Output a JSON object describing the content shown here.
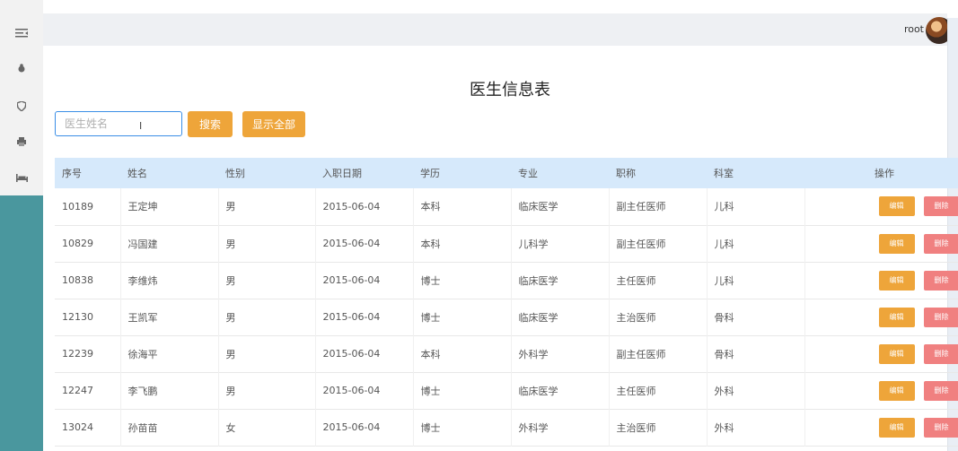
{
  "sidebar": {
    "icons": [
      "menu-icon",
      "bug-icon",
      "shield-icon",
      "printer-icon",
      "bed-icon"
    ],
    "accent_color": "#4a979e"
  },
  "header": {
    "username": "root"
  },
  "page": {
    "title": "医生信息表"
  },
  "search": {
    "placeholder": "医生姓名",
    "search_label": "搜索",
    "show_all_label": "显示全部",
    "button_color": "#eea53a"
  },
  "table": {
    "columns": [
      "序号",
      "姓名",
      "性别",
      "入职日期",
      "学历",
      "专业",
      "职称",
      "科室",
      "操作"
    ],
    "edit_label": "编辑",
    "delete_label": "删除",
    "rows": [
      {
        "id": "10189",
        "name": "王定坤",
        "gender": "男",
        "date": "2015-06-04",
        "edu": "本科",
        "major": "临床医学",
        "title": "副主任医师",
        "dept": "儿科"
      },
      {
        "id": "10829",
        "name": "冯国建",
        "gender": "男",
        "date": "2015-06-04",
        "edu": "本科",
        "major": "儿科学",
        "title": "副主任医师",
        "dept": "儿科"
      },
      {
        "id": "10838",
        "name": "李维炜",
        "gender": "男",
        "date": "2015-06-04",
        "edu": "博士",
        "major": "临床医学",
        "title": "主任医师",
        "dept": "儿科"
      },
      {
        "id": "12130",
        "name": "王凯军",
        "gender": "男",
        "date": "2015-06-04",
        "edu": "博士",
        "major": "临床医学",
        "title": "主治医师",
        "dept": "骨科"
      },
      {
        "id": "12239",
        "name": "徐海平",
        "gender": "男",
        "date": "2015-06-04",
        "edu": "本科",
        "major": "外科学",
        "title": "副主任医师",
        "dept": "骨科"
      },
      {
        "id": "12247",
        "name": "李飞鹏",
        "gender": "男",
        "date": "2015-06-04",
        "edu": "博士",
        "major": "临床医学",
        "title": "主任医师",
        "dept": "外科"
      },
      {
        "id": "13024",
        "name": "孙苗苗",
        "gender": "女",
        "date": "2015-06-04",
        "edu": "博士",
        "major": "外科学",
        "title": "主治医师",
        "dept": "外科"
      }
    ]
  }
}
